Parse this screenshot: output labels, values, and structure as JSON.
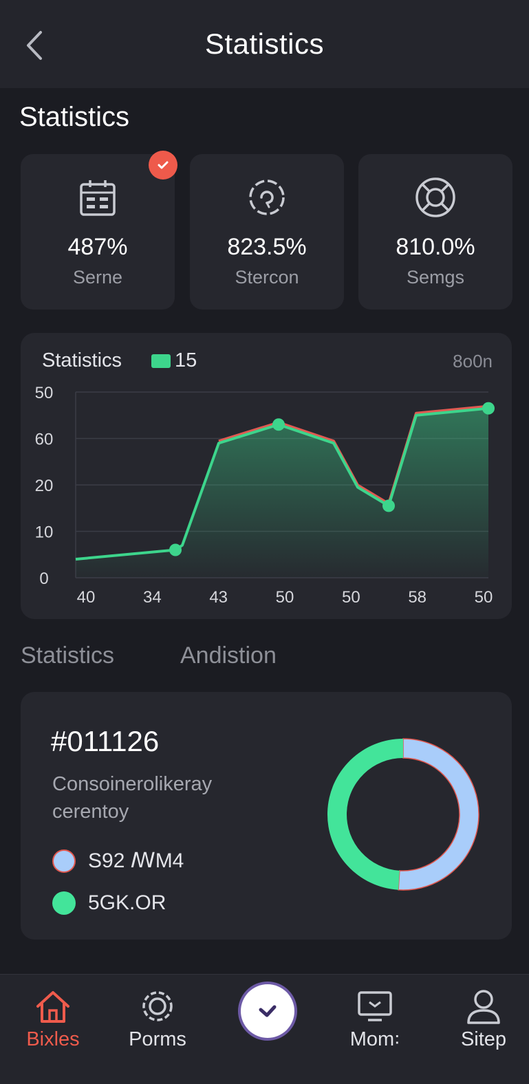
{
  "header": {
    "title": "Statistics",
    "back_icon": "chevron-left-icon"
  },
  "section": {
    "title": "Statistics"
  },
  "stats": [
    {
      "icon": "calendar-icon",
      "value": "487%",
      "label": "Serne",
      "badge": true
    },
    {
      "icon": "refresh-gear-icon",
      "value": "823.5%",
      "label": "Stercon"
    },
    {
      "icon": "lifebuoy-icon",
      "value": "810.0%",
      "label": "Semgs"
    }
  ],
  "chart_card": {
    "title": "Statistics",
    "legend_value": "15",
    "corner_text": "8o0n",
    "colors": {
      "line": "#3dd58c",
      "line_alt": "#e05a52"
    }
  },
  "chart_data": {
    "type": "area",
    "title": "Statistics",
    "y_tick_labels": [
      "50",
      "60",
      "20",
      "10",
      "0"
    ],
    "x_tick_labels": [
      "40",
      "34",
      "43",
      "50",
      "50",
      "58",
      "50"
    ],
    "ylim": [
      0,
      80
    ],
    "grid": true,
    "series": [
      {
        "name": "15",
        "x": [
          0,
          1.45,
          1.55,
          2.08,
          2.95,
          3.75,
          4.1,
          4.55,
          4.95,
          6.0
        ],
        "values": [
          8,
          12,
          14,
          58,
          66,
          58,
          39,
          31,
          70,
          73
        ],
        "markers": [
          1.45,
          2.95,
          4.55,
          6.0
        ]
      }
    ]
  },
  "tabs": [
    {
      "label": "Statistics"
    },
    {
      "label": "Andistion"
    }
  ],
  "donut_card": {
    "id": "#011126",
    "description": "Consoinerolikeray cerentoy",
    "legend": [
      {
        "label": "S92 ꟿM4",
        "color": "#a9cdfa"
      },
      {
        "label": "5GK.OR",
        "color": "#43e49a"
      }
    ],
    "donut": {
      "slices": [
        {
          "label": "S92 ꟿM4",
          "value": 51,
          "color": "#a9cdfa"
        },
        {
          "label": "5GK.OR",
          "value": 49,
          "color": "#43e49a"
        }
      ]
    }
  },
  "bottom_nav": [
    {
      "icon": "home-icon",
      "label": "Bixles",
      "active": true
    },
    {
      "icon": "gear-icon",
      "label": "Porms",
      "active": false
    },
    {
      "icon": "check-icon",
      "label": "",
      "active": false
    },
    {
      "icon": "monitor-icon",
      "label": "Mom꞉",
      "active": false
    },
    {
      "icon": "user-icon",
      "label": "Sitep",
      "active": false
    }
  ]
}
